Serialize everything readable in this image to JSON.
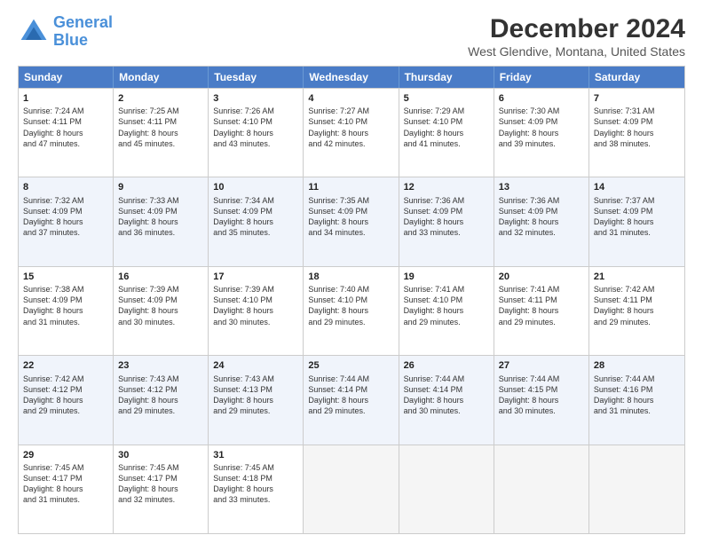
{
  "header": {
    "logo_line1": "General",
    "logo_line2": "Blue",
    "main_title": "December 2024",
    "subtitle": "West Glendive, Montana, United States"
  },
  "weekdays": [
    "Sunday",
    "Monday",
    "Tuesday",
    "Wednesday",
    "Thursday",
    "Friday",
    "Saturday"
  ],
  "rows": [
    {
      "alt": false,
      "cells": [
        {
          "day": "1",
          "lines": [
            "Sunrise: 7:24 AM",
            "Sunset: 4:11 PM",
            "Daylight: 8 hours",
            "and 47 minutes."
          ]
        },
        {
          "day": "2",
          "lines": [
            "Sunrise: 7:25 AM",
            "Sunset: 4:11 PM",
            "Daylight: 8 hours",
            "and 45 minutes."
          ]
        },
        {
          "day": "3",
          "lines": [
            "Sunrise: 7:26 AM",
            "Sunset: 4:10 PM",
            "Daylight: 8 hours",
            "and 43 minutes."
          ]
        },
        {
          "day": "4",
          "lines": [
            "Sunrise: 7:27 AM",
            "Sunset: 4:10 PM",
            "Daylight: 8 hours",
            "and 42 minutes."
          ]
        },
        {
          "day": "5",
          "lines": [
            "Sunrise: 7:29 AM",
            "Sunset: 4:10 PM",
            "Daylight: 8 hours",
            "and 41 minutes."
          ]
        },
        {
          "day": "6",
          "lines": [
            "Sunrise: 7:30 AM",
            "Sunset: 4:09 PM",
            "Daylight: 8 hours",
            "and 39 minutes."
          ]
        },
        {
          "day": "7",
          "lines": [
            "Sunrise: 7:31 AM",
            "Sunset: 4:09 PM",
            "Daylight: 8 hours",
            "and 38 minutes."
          ]
        }
      ]
    },
    {
      "alt": true,
      "cells": [
        {
          "day": "8",
          "lines": [
            "Sunrise: 7:32 AM",
            "Sunset: 4:09 PM",
            "Daylight: 8 hours",
            "and 37 minutes."
          ]
        },
        {
          "day": "9",
          "lines": [
            "Sunrise: 7:33 AM",
            "Sunset: 4:09 PM",
            "Daylight: 8 hours",
            "and 36 minutes."
          ]
        },
        {
          "day": "10",
          "lines": [
            "Sunrise: 7:34 AM",
            "Sunset: 4:09 PM",
            "Daylight: 8 hours",
            "and 35 minutes."
          ]
        },
        {
          "day": "11",
          "lines": [
            "Sunrise: 7:35 AM",
            "Sunset: 4:09 PM",
            "Daylight: 8 hours",
            "and 34 minutes."
          ]
        },
        {
          "day": "12",
          "lines": [
            "Sunrise: 7:36 AM",
            "Sunset: 4:09 PM",
            "Daylight: 8 hours",
            "and 33 minutes."
          ]
        },
        {
          "day": "13",
          "lines": [
            "Sunrise: 7:36 AM",
            "Sunset: 4:09 PM",
            "Daylight: 8 hours",
            "and 32 minutes."
          ]
        },
        {
          "day": "14",
          "lines": [
            "Sunrise: 7:37 AM",
            "Sunset: 4:09 PM",
            "Daylight: 8 hours",
            "and 31 minutes."
          ]
        }
      ]
    },
    {
      "alt": false,
      "cells": [
        {
          "day": "15",
          "lines": [
            "Sunrise: 7:38 AM",
            "Sunset: 4:09 PM",
            "Daylight: 8 hours",
            "and 31 minutes."
          ]
        },
        {
          "day": "16",
          "lines": [
            "Sunrise: 7:39 AM",
            "Sunset: 4:09 PM",
            "Daylight: 8 hours",
            "and 30 minutes."
          ]
        },
        {
          "day": "17",
          "lines": [
            "Sunrise: 7:39 AM",
            "Sunset: 4:10 PM",
            "Daylight: 8 hours",
            "and 30 minutes."
          ]
        },
        {
          "day": "18",
          "lines": [
            "Sunrise: 7:40 AM",
            "Sunset: 4:10 PM",
            "Daylight: 8 hours",
            "and 29 minutes."
          ]
        },
        {
          "day": "19",
          "lines": [
            "Sunrise: 7:41 AM",
            "Sunset: 4:10 PM",
            "Daylight: 8 hours",
            "and 29 minutes."
          ]
        },
        {
          "day": "20",
          "lines": [
            "Sunrise: 7:41 AM",
            "Sunset: 4:11 PM",
            "Daylight: 8 hours",
            "and 29 minutes."
          ]
        },
        {
          "day": "21",
          "lines": [
            "Sunrise: 7:42 AM",
            "Sunset: 4:11 PM",
            "Daylight: 8 hours",
            "and 29 minutes."
          ]
        }
      ]
    },
    {
      "alt": true,
      "cells": [
        {
          "day": "22",
          "lines": [
            "Sunrise: 7:42 AM",
            "Sunset: 4:12 PM",
            "Daylight: 8 hours",
            "and 29 minutes."
          ]
        },
        {
          "day": "23",
          "lines": [
            "Sunrise: 7:43 AM",
            "Sunset: 4:12 PM",
            "Daylight: 8 hours",
            "and 29 minutes."
          ]
        },
        {
          "day": "24",
          "lines": [
            "Sunrise: 7:43 AM",
            "Sunset: 4:13 PM",
            "Daylight: 8 hours",
            "and 29 minutes."
          ]
        },
        {
          "day": "25",
          "lines": [
            "Sunrise: 7:44 AM",
            "Sunset: 4:14 PM",
            "Daylight: 8 hours",
            "and 29 minutes."
          ]
        },
        {
          "day": "26",
          "lines": [
            "Sunrise: 7:44 AM",
            "Sunset: 4:14 PM",
            "Daylight: 8 hours",
            "and 30 minutes."
          ]
        },
        {
          "day": "27",
          "lines": [
            "Sunrise: 7:44 AM",
            "Sunset: 4:15 PM",
            "Daylight: 8 hours",
            "and 30 minutes."
          ]
        },
        {
          "day": "28",
          "lines": [
            "Sunrise: 7:44 AM",
            "Sunset: 4:16 PM",
            "Daylight: 8 hours",
            "and 31 minutes."
          ]
        }
      ]
    },
    {
      "alt": false,
      "cells": [
        {
          "day": "29",
          "lines": [
            "Sunrise: 7:45 AM",
            "Sunset: 4:17 PM",
            "Daylight: 8 hours",
            "and 31 minutes."
          ]
        },
        {
          "day": "30",
          "lines": [
            "Sunrise: 7:45 AM",
            "Sunset: 4:17 PM",
            "Daylight: 8 hours",
            "and 32 minutes."
          ]
        },
        {
          "day": "31",
          "lines": [
            "Sunrise: 7:45 AM",
            "Sunset: 4:18 PM",
            "Daylight: 8 hours",
            "and 33 minutes."
          ]
        },
        {
          "day": "",
          "lines": []
        },
        {
          "day": "",
          "lines": []
        },
        {
          "day": "",
          "lines": []
        },
        {
          "day": "",
          "lines": []
        }
      ]
    }
  ]
}
